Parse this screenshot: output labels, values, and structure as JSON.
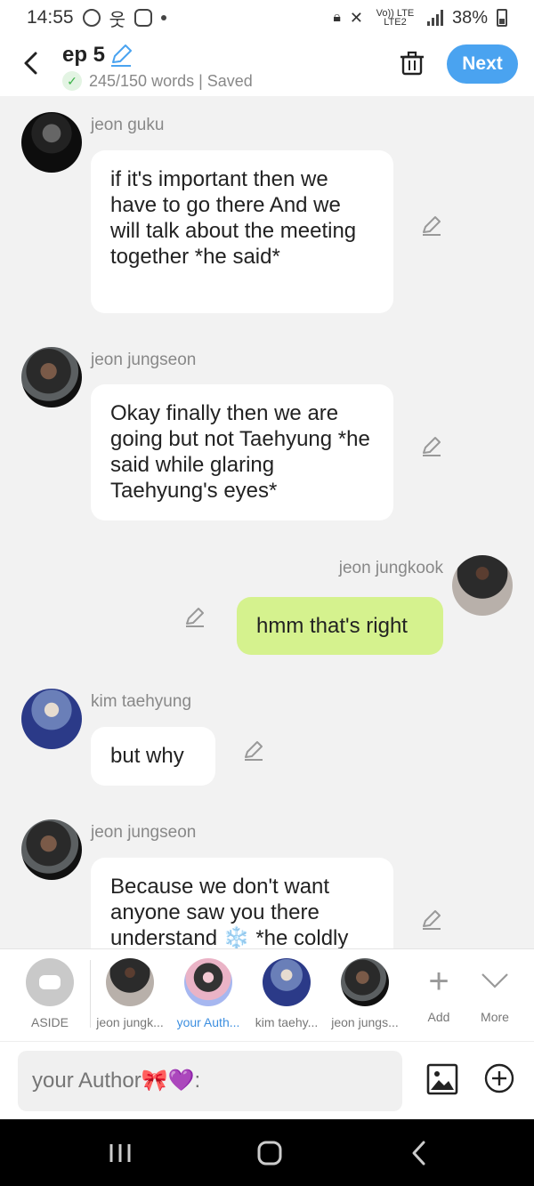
{
  "status": {
    "time": "14:55",
    "carrier": "Vo)) LTE LTE2",
    "battery": "38%"
  },
  "header": {
    "title": "ep 5",
    "wordcount": "245/150 words | Saved",
    "next_label": "Next"
  },
  "messages": [
    {
      "sender": "jeon guku",
      "text": "if it's important then we have to go there And we will talk about the meeting together *he said*",
      "side": "left"
    },
    {
      "sender": "jeon jungseon",
      "text": "Okay finally then we are going but not Taehyung *he said while glaring Taehyung's eyes*",
      "side": "left"
    },
    {
      "sender": "jeon jungkook",
      "text": "hmm that's right",
      "side": "right"
    },
    {
      "sender": "kim taehyung",
      "text": "but why",
      "side": "left"
    },
    {
      "sender": "jeon jungseon",
      "text": "Because we don't want anyone saw you there understand ❄️ *he coldly",
      "side": "left"
    }
  ],
  "characters": [
    {
      "label": "ASIDE"
    },
    {
      "label": "jeon jungk..."
    },
    {
      "label": "your Auth..."
    },
    {
      "label": "kim taehy..."
    },
    {
      "label": "jeon jungs..."
    }
  ],
  "tools": {
    "add_label": "Add",
    "more_label": "More"
  },
  "input": {
    "placeholder": "your Author🎀💜:"
  },
  "colors": {
    "accent": "#4aa3f0",
    "own_bubble": "#d5f28e",
    "active_character": "#3d8fe0"
  }
}
